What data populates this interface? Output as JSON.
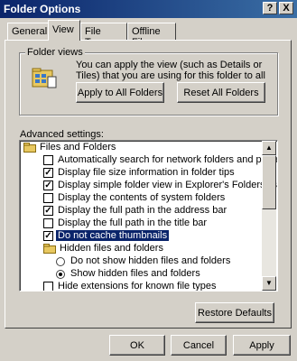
{
  "window": {
    "title": "Folder Options",
    "help_glyph": "?",
    "close_glyph": "X"
  },
  "tabs": [
    {
      "label": "General"
    },
    {
      "label": "View"
    },
    {
      "label": "File Types"
    },
    {
      "label": "Offline Files"
    }
  ],
  "folder_views": {
    "legend": "Folder views",
    "description": "You can apply the view (such as Details or Tiles) that you are using for this folder to all folders.",
    "apply_button": "Apply to All Folders",
    "reset_button": "Reset All Folders",
    "icon": "folder-views-icon"
  },
  "advanced": {
    "label": "Advanced settings:",
    "items": [
      {
        "type": "folder",
        "label": "Files and Folders"
      },
      {
        "type": "checkbox",
        "checked": false,
        "label": "Automatically search for network folders and printers"
      },
      {
        "type": "checkbox",
        "checked": true,
        "label": "Display file size information in folder tips"
      },
      {
        "type": "checkbox",
        "checked": true,
        "label": "Display simple folder view in Explorer's Folders list"
      },
      {
        "type": "checkbox",
        "checked": false,
        "label": "Display the contents of system folders"
      },
      {
        "type": "checkbox",
        "checked": true,
        "label": "Display the full path in the address bar"
      },
      {
        "type": "checkbox",
        "checked": false,
        "label": "Display the full path in the title bar"
      },
      {
        "type": "checkbox",
        "checked": true,
        "label": "Do not cache thumbnails",
        "selected": true
      },
      {
        "type": "folder",
        "label": "Hidden files and folders"
      },
      {
        "type": "radio",
        "checked": false,
        "label": "Do not show hidden files and folders"
      },
      {
        "type": "radio",
        "checked": true,
        "label": "Show hidden files and folders"
      },
      {
        "type": "checkbox",
        "checked": false,
        "label": "Hide extensions for known file types"
      }
    ],
    "restore_button": "Restore Defaults",
    "scroll_up_glyph": "▲",
    "scroll_down_glyph": "▼"
  },
  "footer": {
    "ok": "OK",
    "cancel": "Cancel",
    "apply": "Apply"
  },
  "colors": {
    "titlebar": "#0a246a",
    "face": "#d4d0c8",
    "selection": "#0a246a"
  }
}
